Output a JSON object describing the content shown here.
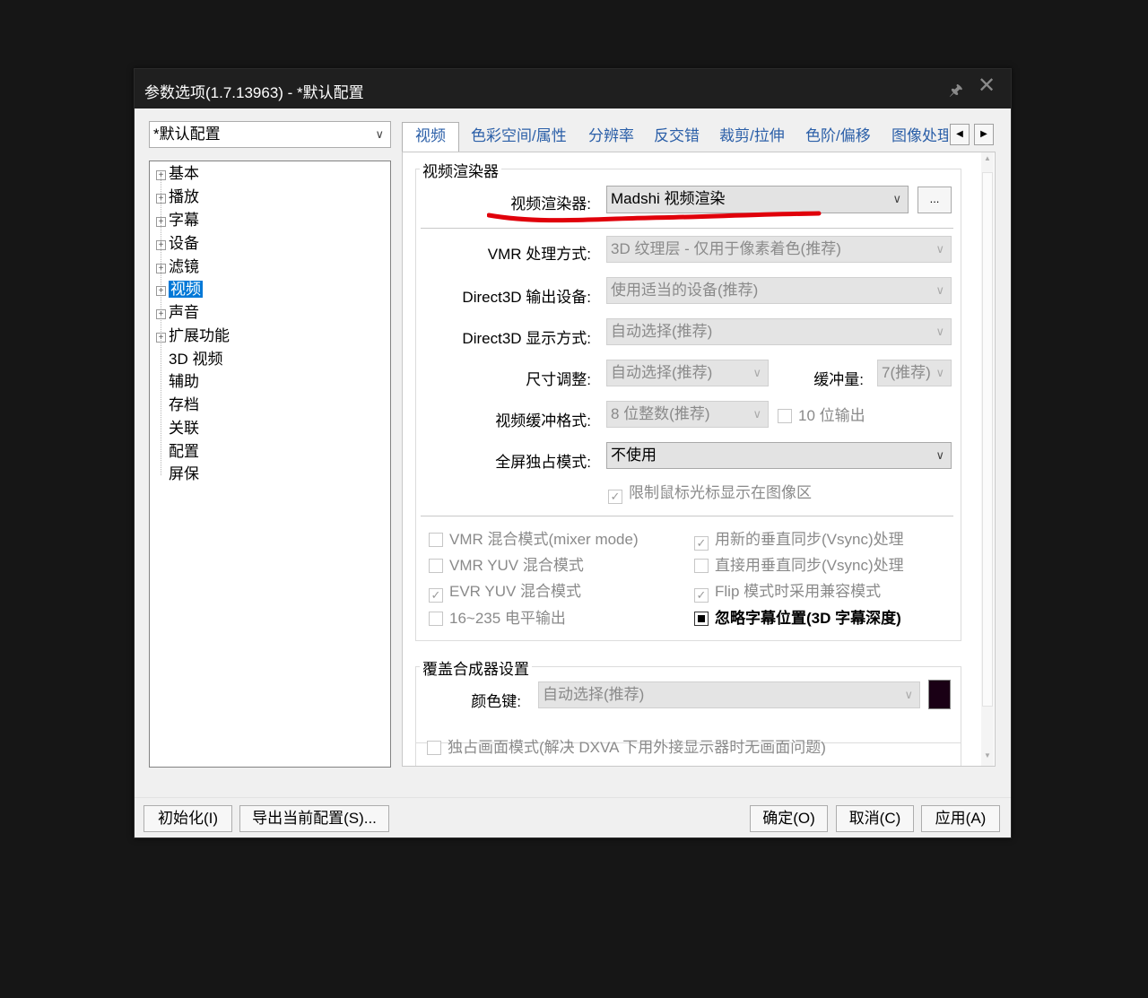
{
  "window": {
    "title": "参数选项(1.7.13963) - *默认配置"
  },
  "profile": {
    "selected": "*默认配置"
  },
  "tree": [
    {
      "label": "基本",
      "expandable": true,
      "selected": false
    },
    {
      "label": "播放",
      "expandable": true,
      "selected": false
    },
    {
      "label": "字幕",
      "expandable": true,
      "selected": false
    },
    {
      "label": "设备",
      "expandable": true,
      "selected": false
    },
    {
      "label": "滤镜",
      "expandable": true,
      "selected": false
    },
    {
      "label": "视频",
      "expandable": true,
      "selected": true
    },
    {
      "label": "声音",
      "expandable": true,
      "selected": false
    },
    {
      "label": "扩展功能",
      "expandable": true,
      "selected": false
    },
    {
      "label": "3D 视频",
      "expandable": false,
      "selected": false
    },
    {
      "label": "辅助",
      "expandable": false,
      "selected": false
    },
    {
      "label": "存档",
      "expandable": false,
      "selected": false
    },
    {
      "label": "关联",
      "expandable": false,
      "selected": false
    },
    {
      "label": "配置",
      "expandable": false,
      "selected": false
    },
    {
      "label": "屏保",
      "expandable": false,
      "selected": false
    }
  ],
  "tabs": [
    "视频",
    "色彩空间/属性",
    "分辨率",
    "反交错",
    "裁剪/拉伸",
    "色阶/偏移",
    "图像处理"
  ],
  "renderer_group": {
    "title": "视频渲染器",
    "renderer_label": "视频渲染器:",
    "renderer_value": "Madshi 视频渲染",
    "dots_label": "...",
    "vmr_label": "VMR 处理方式:",
    "vmr_value": "3D 纹理层 - 仅用于像素着色(推荐)",
    "d3d_device_label": "Direct3D 输出设备:",
    "d3d_device_value": "使用适当的设备(推荐)",
    "d3d_display_label": "Direct3D 显示方式:",
    "d3d_display_value": "自动选择(推荐)",
    "resize_label": "尺寸调整:",
    "resize_value": "自动选择(推荐)",
    "buffer_label": "缓冲量:",
    "buffer_value": "7(推荐)",
    "bufformat_label": "视频缓冲格式:",
    "bufformat_value": "8 位整数(推荐)",
    "tenbit_label": "10 位输出",
    "fullscreen_label": "全屏独占模式:",
    "fullscreen_value": "不使用",
    "limit_cursor_label": "限制鼠标光标显示在图像区",
    "checks": [
      {
        "label": "VMR 混合模式(mixer mode)",
        "checked": false
      },
      {
        "label": "用新的垂直同步(Vsync)处理",
        "checked": true
      },
      {
        "label": "VMR YUV 混合模式",
        "checked": false
      },
      {
        "label": "直接用垂直同步(Vsync)处理",
        "checked": false
      },
      {
        "label": "EVR YUV 混合模式",
        "checked": true
      },
      {
        "label": "Flip 模式时采用兼容模式",
        "checked": true
      },
      {
        "label": "16~235 电平输出",
        "checked": false
      },
      {
        "label": "忽略字幕位置(3D 字幕深度)",
        "checked": true
      }
    ]
  },
  "overlay_group": {
    "title": "覆盖合成器设置",
    "colorkey_label": "颜色键:",
    "colorkey_value": "自动选择(推荐)",
    "swatch_color": "#1a0015",
    "exclusive_label": "独占画面模式(解决 DXVA 下用外接显示器时无画面问题)"
  },
  "buttons": {
    "init": "初始化(I)",
    "export": "导出当前配置(S)...",
    "ok": "确定(O)",
    "cancel": "取消(C)",
    "apply": "应用(A)"
  },
  "annotation_color": "#e0000a"
}
